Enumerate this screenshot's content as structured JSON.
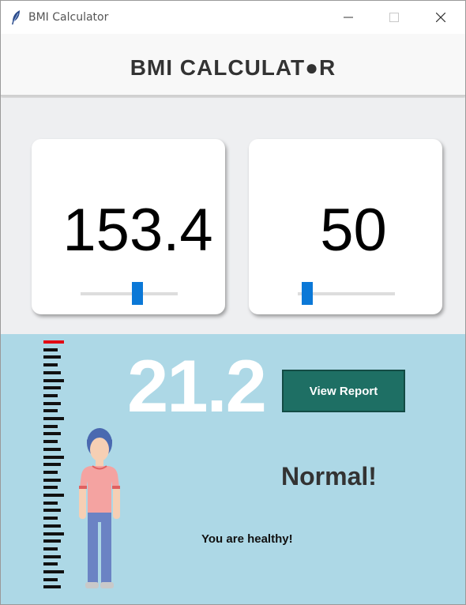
{
  "window": {
    "title": "BMI Calculator",
    "controls": [
      "minimize-icon",
      "maximize-icon",
      "close-icon"
    ]
  },
  "header": {
    "heading": "BMI CALCULAT●R"
  },
  "height_card": {
    "value": "153.4",
    "slider_level": 0.6
  },
  "weight_card": {
    "value": "50",
    "slider_level": 0.05
  },
  "result": {
    "bmi": "21.2",
    "report_button": "View Report",
    "status": "Normal!",
    "message": "You are healthy!"
  },
  "colors": {
    "slider_thumb": "#0b78d7",
    "result_background": "#add8e6",
    "report_button": "#1e6f64",
    "ruler_top_tick": "#e30613"
  }
}
